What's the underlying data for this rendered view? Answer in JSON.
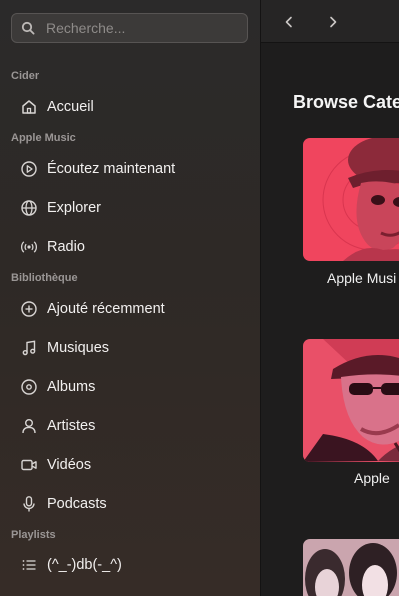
{
  "search": {
    "placeholder": "Recherche..."
  },
  "sidebar": {
    "sections": [
      {
        "title": "Cider",
        "items": [
          {
            "label": "Accueil",
            "icon": "home-icon"
          }
        ]
      },
      {
        "title": "Apple Music",
        "items": [
          {
            "label": "Écoutez maintenant",
            "icon": "play-circle-icon"
          },
          {
            "label": "Explorer",
            "icon": "globe-icon"
          },
          {
            "label": "Radio",
            "icon": "radio-icon"
          }
        ]
      },
      {
        "title": "Bibliothèque",
        "items": [
          {
            "label": "Ajouté récemment",
            "icon": "plus-circle-icon"
          },
          {
            "label": "Musiques",
            "icon": "music-note-icon"
          },
          {
            "label": "Albums",
            "icon": "album-icon"
          },
          {
            "label": "Artistes",
            "icon": "person-icon"
          },
          {
            "label": "Vidéos",
            "icon": "video-icon"
          },
          {
            "label": "Podcasts",
            "icon": "microphone-icon"
          }
        ]
      },
      {
        "title": "Playlists",
        "items": [
          {
            "label": "(^_-)db(-_^)",
            "icon": "list-icon"
          }
        ]
      }
    ]
  },
  "main": {
    "heading": "Browse Cate",
    "cards": [
      {
        "label": "Apple Musi"
      },
      {
        "label": "Apple"
      },
      {
        "label": ""
      }
    ]
  },
  "colors": {
    "accent": "#ff2d55",
    "sidebar_text": "#f2f0ef",
    "section_text": "#9a9695"
  }
}
